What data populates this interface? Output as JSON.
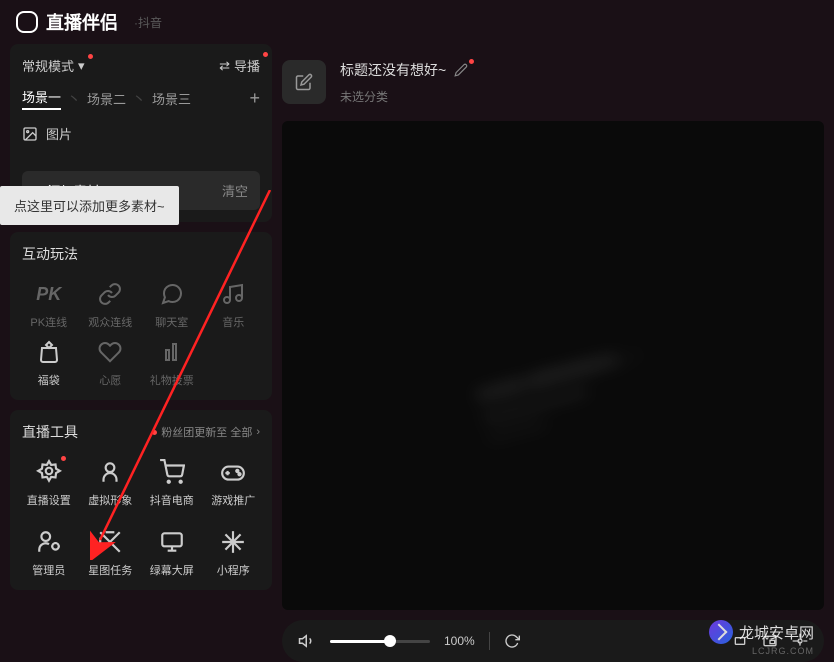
{
  "header": {
    "logo": "直播伴侣",
    "sub": "·抖音"
  },
  "mode": {
    "label": "常规模式",
    "switch": "导播"
  },
  "scenes": {
    "items": [
      "场景一",
      "场景二",
      "场景三"
    ],
    "active": 0
  },
  "source": {
    "image": "图片"
  },
  "tooltip": "点这里可以添加更多素材~",
  "add_source": {
    "add": "添加素材",
    "clear": "清空"
  },
  "interaction": {
    "title": "互动玩法",
    "items": [
      {
        "label": "PK连线",
        "icon": "pk"
      },
      {
        "label": "观众连线",
        "icon": "link"
      },
      {
        "label": "聊天室",
        "icon": "chat"
      },
      {
        "label": "音乐",
        "icon": "music"
      },
      {
        "label": "福袋",
        "icon": "bag"
      },
      {
        "label": "心愿",
        "icon": "wish"
      },
      {
        "label": "礼物投票",
        "icon": "vote"
      }
    ]
  },
  "tools": {
    "title": "直播工具",
    "badge": "粉丝团更新至 全部",
    "items": [
      {
        "label": "直播设置",
        "icon": "gear",
        "dot": true
      },
      {
        "label": "虚拟形象",
        "icon": "avatar"
      },
      {
        "label": "抖音电商",
        "icon": "cart"
      },
      {
        "label": "游戏推广",
        "icon": "gamepad"
      },
      {
        "label": "管理员",
        "icon": "admin"
      },
      {
        "label": "星图任务",
        "icon": "star"
      },
      {
        "label": "绿幕大屏",
        "icon": "screen"
      },
      {
        "label": "小程序",
        "icon": "mini"
      }
    ]
  },
  "title_block": {
    "title": "标题还没有想好~",
    "category": "未选分类"
  },
  "controls": {
    "volume": "100%"
  },
  "watermark": {
    "text": "龙城安卓网",
    "url": "LCJRG.COM"
  }
}
